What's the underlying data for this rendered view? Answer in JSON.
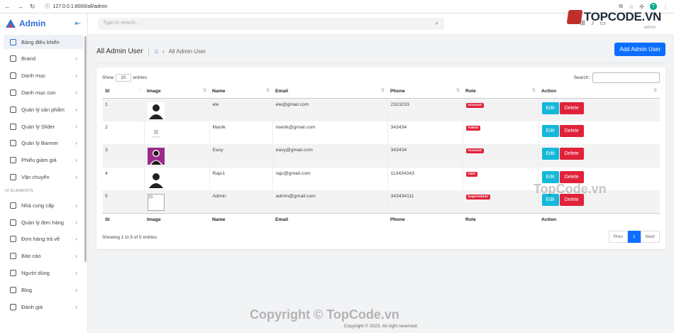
{
  "browser": {
    "url": "127.0.0.1:8000/all/admin",
    "profile_initial": "T"
  },
  "sidebar": {
    "title": "Admin",
    "items": [
      {
        "label": "Bảng điều khiển",
        "icon": "dashboard-icon",
        "active": true
      },
      {
        "label": "Brand",
        "icon": "palette-icon"
      },
      {
        "label": "Danh mục",
        "icon": "grid-icon"
      },
      {
        "label": "Danh mục con",
        "icon": "cube-icon"
      },
      {
        "label": "Quản lý sản phẩm",
        "icon": "truck-icon"
      },
      {
        "label": "Quản lý Slider",
        "icon": "slider-icon"
      },
      {
        "label": "Quản lý Banner",
        "icon": "banner-icon"
      },
      {
        "label": "Phiếu giảm giá",
        "icon": "sun-icon"
      },
      {
        "label": "Vận chuyển",
        "icon": "shipping-icon"
      }
    ],
    "section_label": "UI ELEMENTS",
    "items2": [
      {
        "label": "Nhà cung cấp",
        "icon": "network-icon"
      },
      {
        "label": "Quản lý đơn hàng",
        "icon": "cart-icon"
      },
      {
        "label": "Đơn hàng trả về",
        "icon": "paperclip-icon"
      },
      {
        "label": "Báo cáo",
        "icon": "chart-icon"
      },
      {
        "label": "Người dùng",
        "icon": "users-icon"
      },
      {
        "label": "Blog",
        "icon": "mountain-icon"
      },
      {
        "label": "Đánh giá",
        "icon": "rating-icon"
      }
    ]
  },
  "topbar": {
    "search_placeholder": "Type to search...",
    "user_role": "admin"
  },
  "watermark": {
    "top": "TOPCODE.VN",
    "middle": "TopCode.vn",
    "bottom": "Copyright © TopCode.vn"
  },
  "page": {
    "title": "All Admin User",
    "breadcrumb": "All Admin User",
    "add_button": "Add Admin User"
  },
  "table": {
    "show_label": "Show",
    "show_value": "10",
    "entries_label": "entries",
    "search_label": "Search:",
    "columns": [
      "Sl",
      "Image",
      "Name",
      "Email",
      "Phone",
      "Role",
      "Action"
    ],
    "rows": [
      {
        "sl": "1",
        "image": "person-black",
        "name": "ele",
        "email": "ele@gmail.com",
        "phone": "2323233",
        "role": "Account"
      },
      {
        "sl": "2",
        "image": "no-image",
        "name": "Manik",
        "email": "manik@gmail.com",
        "phone": "343434",
        "role": "Admin"
      },
      {
        "sl": "3",
        "image": "person-purple",
        "name": "Easy",
        "email": "easy@gmail.com",
        "phone": "343434",
        "role": "Account"
      },
      {
        "sl": "4",
        "image": "person-black",
        "name": "Raju1",
        "email": "raju@gmail.com",
        "phone": "113434343",
        "role": "CEO"
      },
      {
        "sl": "5",
        "image": "broken",
        "name": "Admin",
        "email": "admin@gmail.com",
        "phone": "343434111",
        "role": "SuperAdmin"
      }
    ],
    "edit_label": "Edit",
    "delete_label": "Delete",
    "info": "Showing 1 to 5 of 5 entries",
    "prev": "Prev",
    "page": "1",
    "next": "Next"
  },
  "footer": "Copyright © 2023. All right reserved."
}
